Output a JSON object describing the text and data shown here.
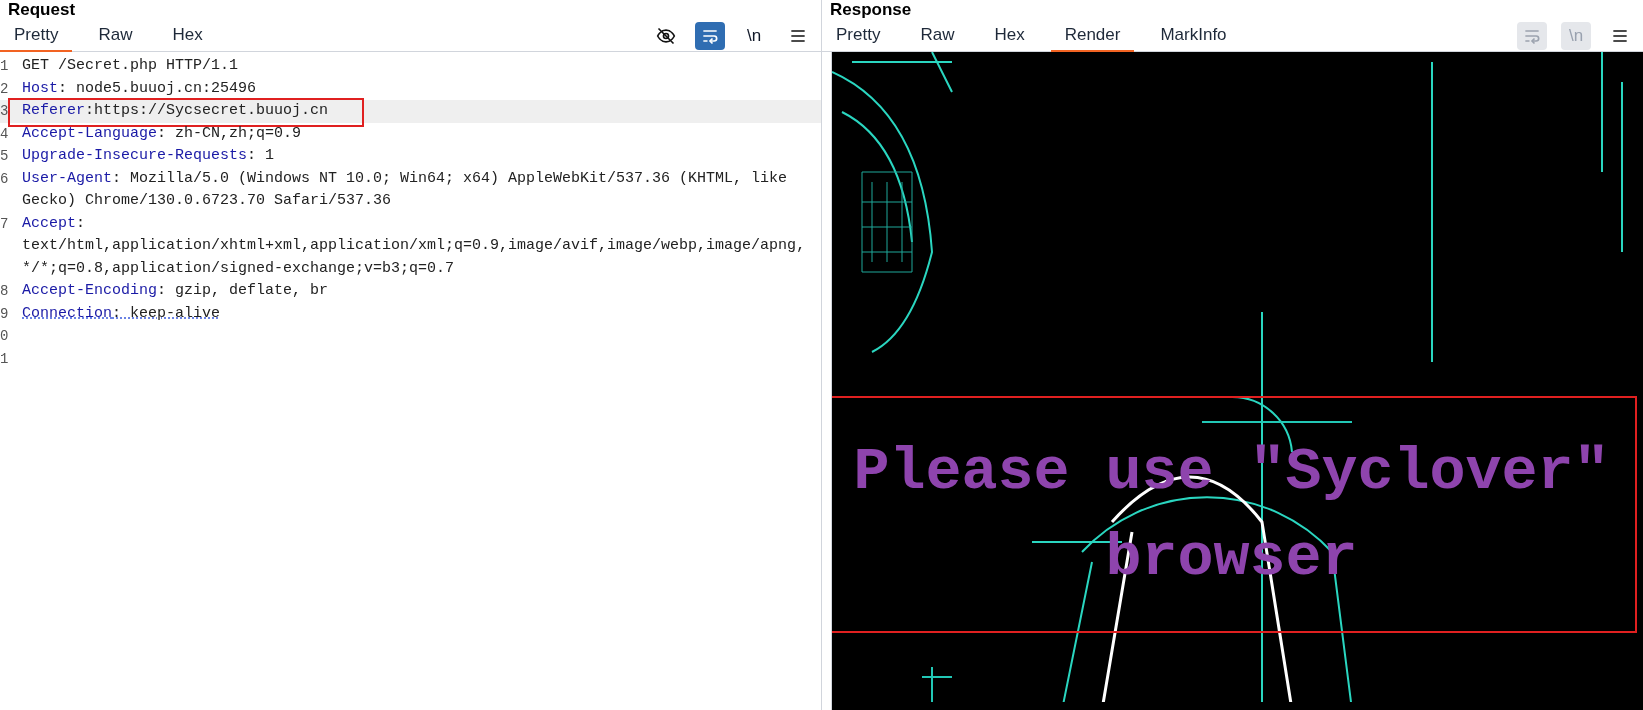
{
  "request": {
    "title": "Request",
    "tabs": [
      {
        "label": "Pretty",
        "selected": true
      },
      {
        "label": "Raw",
        "selected": false
      },
      {
        "label": "Hex",
        "selected": false
      }
    ],
    "toolbar": [
      {
        "kind": "eye-off",
        "disabled": false,
        "selected": false
      },
      {
        "kind": "wrap",
        "disabled": false,
        "selected": true
      },
      {
        "kind": "newline",
        "label": "\\n",
        "disabled": false,
        "selected": false
      },
      {
        "kind": "menu",
        "disabled": false,
        "selected": false
      }
    ],
    "lines": [
      {
        "number": "1",
        "value": "GET /Secret.php HTTP/1.1"
      },
      {
        "number": "2",
        "name": "Host",
        "value": ": node5.buuoj.cn:25496"
      },
      {
        "number": "3",
        "name": "Referer",
        "value": ":https://Sycsecret.buuoj.cn",
        "highlighted": true,
        "boxed": true
      },
      {
        "number": "4",
        "name": "Accept-Language",
        "value": ": zh-CN,zh;q=0.9"
      },
      {
        "number": "5",
        "name": "Upgrade-Insecure-Requests",
        "value": ": 1"
      },
      {
        "number": "6",
        "name": "User-Agent",
        "value": ": Mozilla/5.0 (Windows NT 10.0; Win64; x64) AppleWebKit/537.36 (KHTML, like Gecko) Chrome/130.0.6723.70 Safari/537.36"
      },
      {
        "number": "7",
        "name": "Accept",
        "value": ": text/html,application/xhtml+xml,application/xml;q=0.9,image/avif,image/webp,image/apng,*/*;q=0.8,application/signed-exchange;v=b3;q=0.7"
      },
      {
        "number": "8",
        "name": "Accept-Encoding",
        "value": ": gzip, deflate, br"
      },
      {
        "number": "9",
        "name": "Connection",
        "value": ": keep-alive",
        "spellcheck_error": true
      },
      {
        "number": "0"
      },
      {
        "number": "1"
      }
    ]
  },
  "response": {
    "title": "Response",
    "tabs": [
      {
        "label": "Pretty",
        "selected": false
      },
      {
        "label": "Raw",
        "selected": false
      },
      {
        "label": "Hex",
        "selected": false
      },
      {
        "label": "Render",
        "selected": true
      },
      {
        "label": "MarkInfo",
        "selected": false
      }
    ],
    "toolbar": [
      {
        "kind": "wrap",
        "disabled": true,
        "selected": false
      },
      {
        "kind": "newline",
        "label": "\\n",
        "disabled": true,
        "selected": false
      },
      {
        "kind": "menu",
        "disabled": false,
        "selected": false
      }
    ],
    "render": {
      "message": "Please use \"Syclover\" browser",
      "boxed": true
    }
  }
}
